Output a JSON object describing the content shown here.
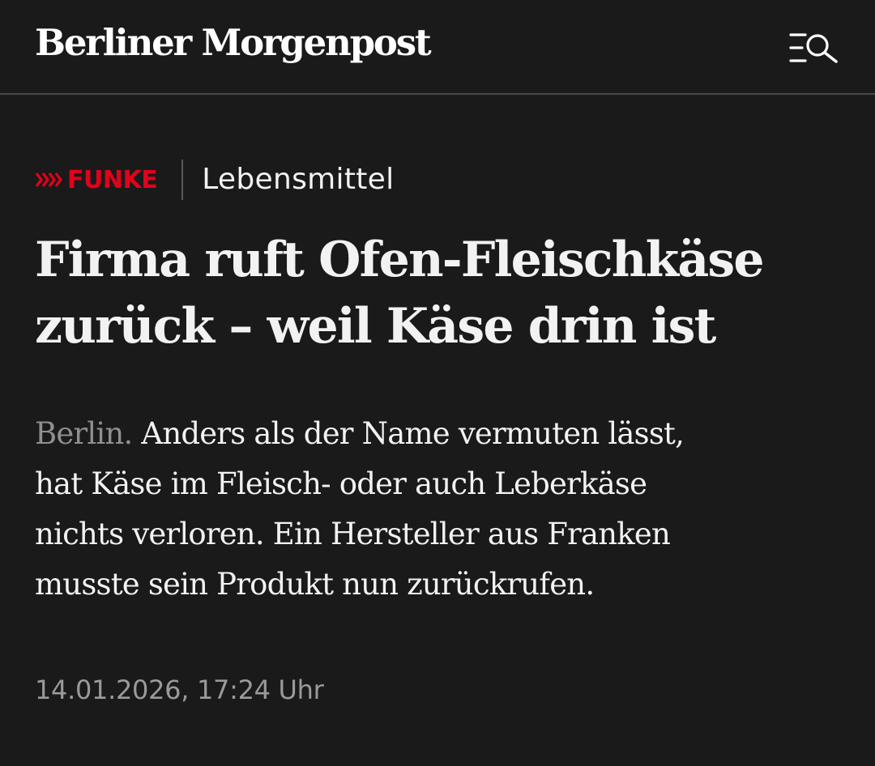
{
  "header": {
    "logo": "Berliner Morgenpost",
    "menu_icon": "menu-search-icon"
  },
  "kicker": {
    "brand_icon": "chevrons-icon",
    "brand": "FUNKE",
    "category": "Lebensmittel"
  },
  "article": {
    "headline_lines": [
      "Firma ruft Ofen-Fleischkäse",
      "zurück – weil Käse drin ist"
    ],
    "dateline": "Berlin.",
    "teaser_lines": [
      " Anders als der Name vermuten lässt,",
      "hat Käse im Fleisch- oder auch Leberkäse",
      "nichts verloren. Ein Hersteller aus Franken",
      "musste sein Produkt nun zurückrufen."
    ],
    "timestamp": "14.01.2026, 17:24 Uhr"
  },
  "colors": {
    "background": "#1a1a1a",
    "text": "#f2f2f2",
    "muted": "#8f8f8f",
    "brand": "#e3001b"
  }
}
